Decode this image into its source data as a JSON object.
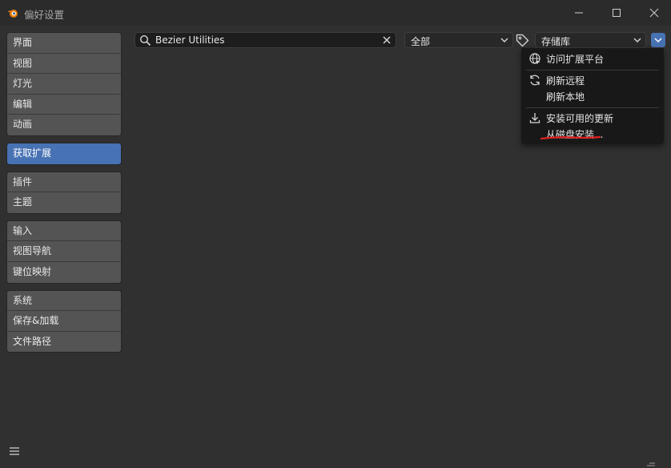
{
  "window": {
    "title": "偏好设置",
    "logo_icon": "blender-logo-icon",
    "controls": [
      "minimize-icon",
      "maximize-icon",
      "close-icon"
    ]
  },
  "sidebar": {
    "groups": [
      [
        "界面",
        "视图",
        "灯光",
        "编辑",
        "动画"
      ],
      [
        "获取扩展"
      ],
      [
        "插件",
        "主题"
      ],
      [
        "输入",
        "视图导航",
        "键位映射"
      ],
      [
        "系统",
        "保存&加载",
        "文件路径"
      ]
    ],
    "active": "获取扩展"
  },
  "toolbar": {
    "search": {
      "value": "Bezier Utilities",
      "icon": "search-icon"
    },
    "filter": {
      "selected": "全部"
    },
    "tag_icon": "tag-icon",
    "repository": {
      "selected": "存储库"
    },
    "menu_toggle_icon": "chevron-down-icon"
  },
  "dropdown": {
    "items": [
      {
        "label": "访问扩展平台",
        "icon": "globe-icon"
      },
      {
        "label": "刷新远程",
        "icon": "refresh-icon"
      },
      {
        "label": "刷新本地",
        "icon": ""
      },
      {
        "label": "安装可用的更新",
        "icon": "download-icon"
      },
      {
        "label": "从磁盘安装...",
        "icon": ""
      }
    ]
  },
  "colors": {
    "accent": "#4772b3",
    "annotation": "#e02020"
  }
}
